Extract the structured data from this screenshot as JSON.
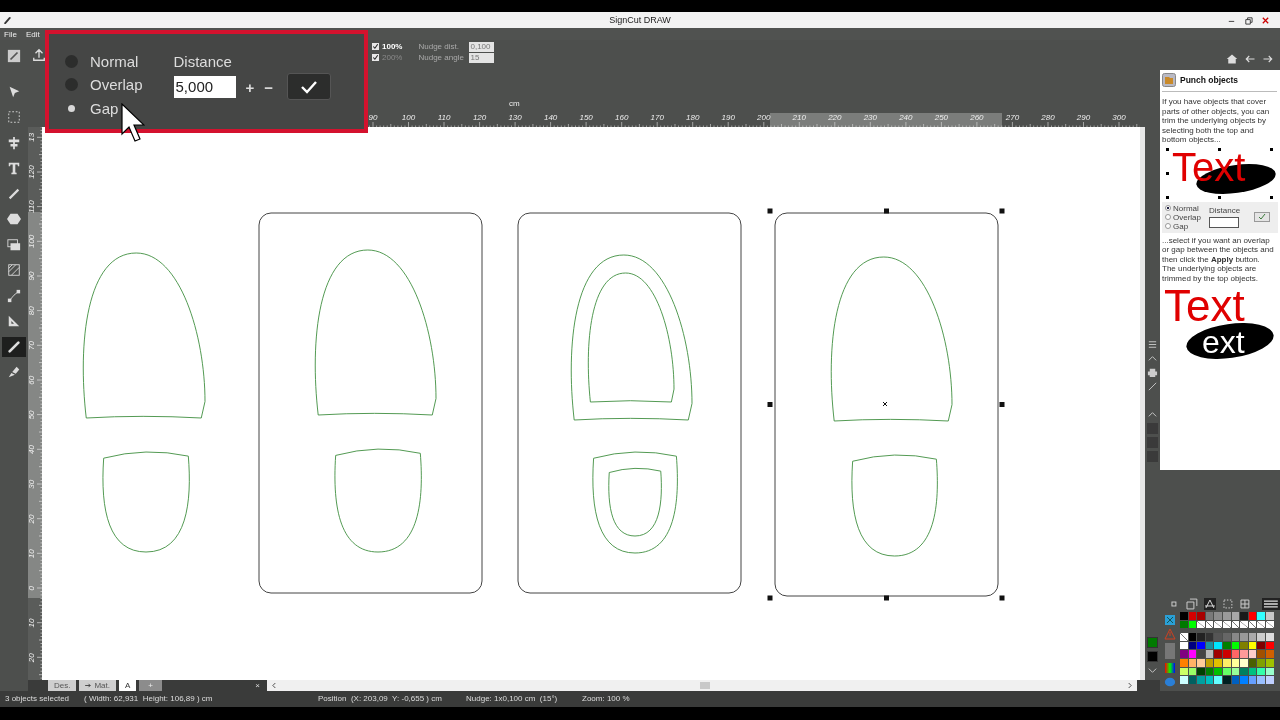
{
  "window": {
    "title": "SignCut DRAW"
  },
  "menu": [
    "File",
    "Edit"
  ],
  "toolbar": {
    "view_options": [
      {
        "label": "100%",
        "checked": true,
        "disabled": false
      },
      {
        "label": "200%",
        "checked": true,
        "disabled": true
      }
    ],
    "nudge_fields": [
      {
        "label": "Nudge dist.",
        "value": "0,100"
      },
      {
        "label": "Nudge angle",
        "value": "15"
      }
    ]
  },
  "tools": [
    {
      "kind": "pen-square",
      "selected": false
    },
    {
      "kind": "pointer",
      "selected": false
    },
    {
      "kind": "marquee",
      "selected": false
    },
    {
      "kind": "align",
      "selected": false
    },
    {
      "kind": "text",
      "selected": false
    },
    {
      "kind": "pencil",
      "selected": false
    },
    {
      "kind": "hexagon",
      "selected": false
    },
    {
      "kind": "images",
      "selected": false
    },
    {
      "kind": "hatch",
      "selected": false
    },
    {
      "kind": "node",
      "selected": false
    },
    {
      "kind": "set-square",
      "selected": false
    },
    {
      "kind": "knife",
      "selected": true
    },
    {
      "kind": "brush",
      "selected": false
    }
  ],
  "punch_dialog": {
    "modes": [
      {
        "label": "Normal",
        "selected": false
      },
      {
        "label": "Overlap",
        "selected": false
      },
      {
        "label": "Gap",
        "selected": true
      }
    ],
    "distance_label": "Distance",
    "distance_value": "5,000",
    "increase": "+",
    "decrease": "−"
  },
  "ruler": {
    "unit": "cm",
    "horizontal_labels": [
      "90",
      "100",
      "110",
      "120",
      "130",
      "140",
      "150",
      "160",
      "170",
      "180",
      "190",
      "200",
      "210",
      "220",
      "230",
      "240",
      "250",
      "260",
      "270",
      "280",
      "290",
      "300"
    ],
    "vertical_labels": [
      "13",
      "120",
      "110",
      "100",
      "90",
      "80",
      "70",
      "60",
      "50",
      "40",
      "30",
      "20",
      "10",
      "0",
      "10",
      "20"
    ]
  },
  "canvas": {
    "groups": [
      {
        "framed": false,
        "offset_outline": false,
        "selected": false
      },
      {
        "framed": true,
        "offset_outline": false,
        "selected": false
      },
      {
        "framed": true,
        "offset_outline": true,
        "selected": false
      },
      {
        "framed": true,
        "offset_outline": false,
        "selected": true
      }
    ]
  },
  "help": {
    "title": "Punch objects",
    "intro": "If you have objects that cover parts of other objects, you can trim the underlying objects by selecting both the top and bottom objects...",
    "example_1_text": "Text",
    "mini_dialog": {
      "modes": [
        {
          "label": "Normal",
          "selected": true
        },
        {
          "label": "Overlap",
          "selected": false
        },
        {
          "label": "Gap",
          "selected": false
        }
      ],
      "distance_label": "Distance"
    },
    "instructions": "...select if you want an overlap or gap between the objects and then click the **Apply** button.",
    "result": "The underlying objects are trimmed by the top objects.",
    "example_2_text": "Text",
    "example_2_cut_text": "ext"
  },
  "palette": {
    "current_colors": [
      {
        "color": "#007a00"
      },
      {
        "color": "#000000"
      }
    ],
    "top_rows": [
      [
        {
          "color": "#000000"
        },
        {
          "color": "#d40000"
        },
        {
          "color": "#a80000"
        },
        {
          "color": "#7a7a7a"
        },
        {
          "color": "#8c8c8c"
        },
        {
          "color": "#9a9a9a"
        },
        {
          "color": "#a8a8a8"
        },
        {
          "color": "#1a1a1a"
        },
        {
          "color": "#ff0000"
        },
        {
          "color": "#33ffff"
        },
        {
          "color": "#c8c8c8"
        }
      ],
      [
        {
          "color": "#007a00"
        },
        {
          "color": "#00ff00"
        },
        {
          "kind": "none"
        },
        {
          "kind": "none"
        },
        {
          "kind": "none"
        },
        {
          "kind": "none"
        },
        {
          "kind": "none"
        },
        {
          "kind": "none"
        },
        {
          "kind": "none"
        },
        {
          "kind": "none"
        },
        {
          "kind": "none"
        }
      ]
    ],
    "rows": [
      [
        {
          "kind": "none"
        },
        {
          "color": "#000000"
        },
        {
          "color": "#222222"
        },
        {
          "color": "#333333"
        },
        {
          "color": "#555555"
        },
        {
          "color": "#666666"
        },
        {
          "color": "#888888"
        },
        {
          "color": "#999999"
        },
        {
          "color": "#aaaaaa"
        },
        {
          "color": "#cccccc"
        },
        {
          "color": "#dddddd"
        }
      ],
      [
        {
          "color": "#ffffff"
        },
        {
          "color": "#000080"
        },
        {
          "color": "#0000ff"
        },
        {
          "color": "#1a8fa0"
        },
        {
          "color": "#00e5ff"
        },
        {
          "color": "#008000"
        },
        {
          "color": "#00ff00"
        },
        {
          "color": "#808000"
        },
        {
          "color": "#ffff00"
        },
        {
          "color": "#800000"
        },
        {
          "color": "#ff0000"
        }
      ],
      [
        {
          "color": "#800080"
        },
        {
          "color": "#ff00ff"
        },
        {
          "color": "#444444"
        },
        {
          "color": "#bbbbbb"
        },
        {
          "color": "#a00000"
        },
        {
          "color": "#cc0000"
        },
        {
          "color": "#ff6666"
        },
        {
          "color": "#ff9999"
        },
        {
          "color": "#ffcccc"
        },
        {
          "color": "#a05000"
        },
        {
          "color": "#d06000"
        }
      ],
      [
        {
          "color": "#ff8000"
        },
        {
          "color": "#ffb366"
        },
        {
          "color": "#ffcc99"
        },
        {
          "color": "#c0a000"
        },
        {
          "color": "#e0c000"
        },
        {
          "color": "#ffee66"
        },
        {
          "color": "#ffff99"
        },
        {
          "color": "#ffffcc"
        },
        {
          "color": "#4a6000"
        },
        {
          "color": "#80a000"
        },
        {
          "color": "#a0c000"
        }
      ],
      [
        {
          "color": "#ccff66"
        },
        {
          "color": "#99ff66"
        },
        {
          "color": "#004000"
        },
        {
          "color": "#008000"
        },
        {
          "color": "#00c000"
        },
        {
          "color": "#66ff66"
        },
        {
          "color": "#99ff99"
        },
        {
          "color": "#008060"
        },
        {
          "color": "#00c080"
        },
        {
          "color": "#33ffaa"
        },
        {
          "color": "#99ffcc"
        }
      ],
      [
        {
          "color": "#ccffff"
        },
        {
          "color": "#006060"
        },
        {
          "color": "#00a0a0"
        },
        {
          "color": "#00c0c0"
        },
        {
          "color": "#66ffff"
        },
        {
          "color": "#002020"
        },
        {
          "color": "#0060c0"
        },
        {
          "color": "#0080ff"
        },
        {
          "color": "#66a0ff"
        },
        {
          "color": "#99c0ff"
        },
        {
          "color": "#c0d0ff"
        }
      ]
    ]
  },
  "document_tabs": [
    {
      "label": "Des.",
      "selected": false
    },
    {
      "label": "Mat.",
      "selected": false
    },
    {
      "label": "A",
      "selected": true
    }
  ],
  "new_tab": "+",
  "close_tab": "×",
  "status_bar": {
    "selection": "3 objects selected",
    "size": "( Width: 62,931  Height: 106,89 ) cm",
    "position": "Position  (X: 203,09  Y: -0,655 ) cm",
    "nudge": "Nudge: 1x0,100 cm  (15°)",
    "zoom": "Zoom: 100 %"
  }
}
